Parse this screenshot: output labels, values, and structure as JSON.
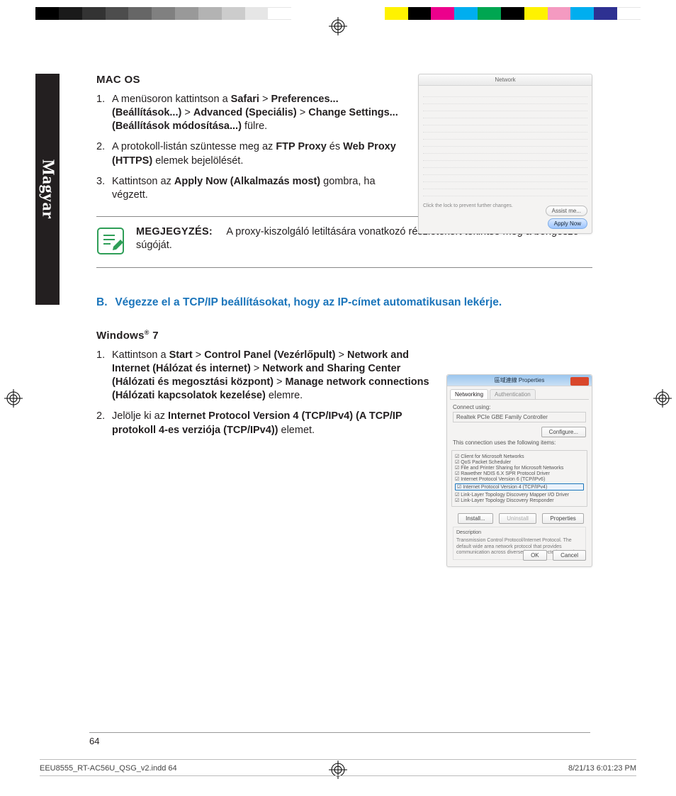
{
  "sidetab": "Magyar",
  "mac": {
    "heading": "MAC OS",
    "steps": [
      {
        "num": "1.",
        "parts": [
          "A menüsoron kattintson a ",
          {
            "b": "Safari"
          },
          " > ",
          {
            "b": "Preferences... (Beállítások...)"
          },
          " > ",
          {
            "b": "Advanced (Speciális)"
          },
          " > ",
          {
            "b": "Change  Settings...(Beállítások módosítása...)"
          },
          " fülre."
        ]
      },
      {
        "num": "2.",
        "parts": [
          "A protokoll-listán szüntesse meg az ",
          {
            "b": "FTP Proxy"
          },
          " és ",
          {
            "b": "Web Proxy (HTTPS)"
          },
          " elemek bejelölését."
        ]
      },
      {
        "num": "3.",
        "parts": [
          "Kattintson az ",
          {
            "b": "Apply Now (Alkalmazás most)"
          },
          " gombra, ha végzett."
        ]
      }
    ],
    "shot": {
      "title": "Network",
      "lock_text": "Click the lock to prevent further changes.",
      "assist": "Assist me...",
      "apply": "Apply Now"
    }
  },
  "note": {
    "label": "MEGJEGYZÉS:",
    "text": "A proxy-kiszolgáló letiltására vonatkozó részletekért tekintse meg a böngésző súgóját."
  },
  "sectionB": {
    "letter": "B.",
    "text": "Végezze el a TCP/IP beállításokat, hogy az IP-címet automatikusan lekérje."
  },
  "win": {
    "heading_pre": "Windows",
    "heading_sup": "®",
    "heading_post": " 7",
    "steps": [
      {
        "num": "1.",
        "parts": [
          "Kattintson a ",
          {
            "b": "Start"
          },
          " > ",
          {
            "b": "Control Panel (Vezérlőpult)"
          },
          " > ",
          {
            "b": "Network and Internet (Hálózat és internet)"
          },
          " > ",
          {
            "b": "Network and Sharing Center (Hálózati és megosztási központ)"
          },
          " > ",
          {
            "b": "Manage network connections (Hálózati kapcsolatok kezelése)"
          },
          " elemre."
        ]
      },
      {
        "num": "2.",
        "parts": [
          "Jelölje ki az ",
          {
            "b": "Internet Protocol Version 4 (TCP/IPv4) (A TCP/IP protokoll 4-es verziója (TCP/IPv4))"
          },
          " elemet."
        ]
      }
    ],
    "shot": {
      "title": "區域連線 Properties",
      "tab1": "Networking",
      "tab2": "Authentication",
      "connect_using": "Connect using:",
      "adapter": "Realtek PCIe GBE Family Controller",
      "configure": "Configure...",
      "uses_following": "This connection uses the following items:",
      "items": [
        "Client for Microsoft Networks",
        "QoS Packet Scheduler",
        "File and Printer Sharing for Microsoft Networks",
        "Rawether NDIS 6.X SPR Protocol Driver",
        "Internet Protocol Version 6 (TCP/IPv6)",
        "Internet Protocol Version 4 (TCP/IPv4)",
        "Link-Layer Topology Discovery Mapper I/O Driver",
        "Link-Layer Topology Discovery Responder"
      ],
      "install": "Install...",
      "uninstall": "Uninstall",
      "properties": "Properties",
      "desc_label": "Description",
      "desc": "Transmission Control Protocol/Internet Protocol. The default wide area network protocol that provides communication across diverse interconnected networks.",
      "ok": "OK",
      "cancel": "Cancel"
    }
  },
  "page_number": "64",
  "slug": {
    "file": "EEU8555_RT-AC56U_QSG_v2.indd   64",
    "stamp": "8/21/13   6:01:23 PM"
  }
}
